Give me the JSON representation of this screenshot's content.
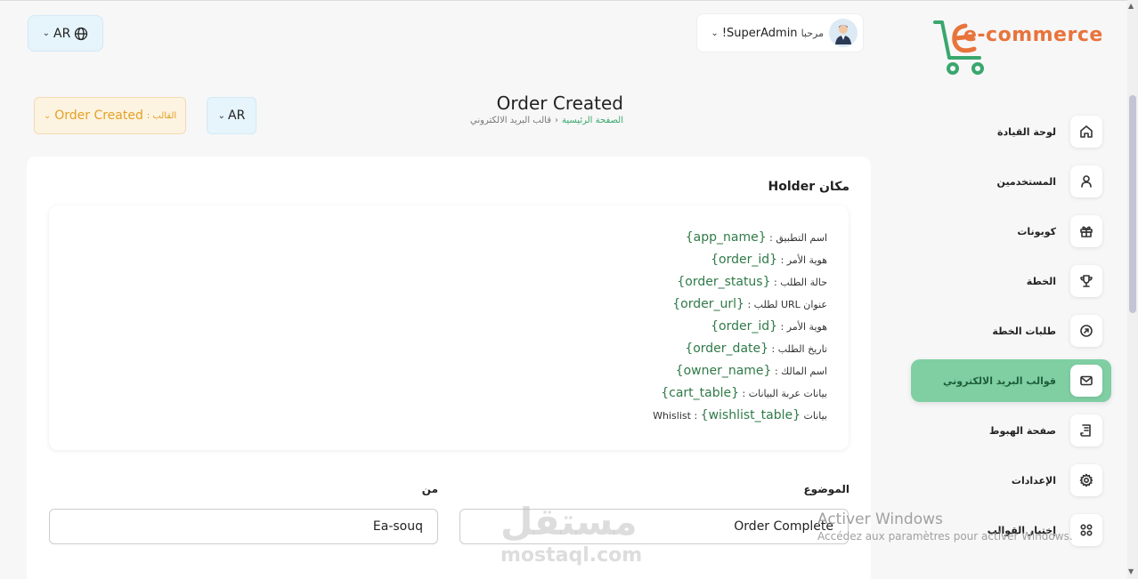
{
  "topbar": {
    "lang_label": "AR",
    "user_greeting": "مرحبا",
    "user_name": "SuperAdmin!",
    "logo_text": "e-commerce"
  },
  "header": {
    "template_label": "القالب :",
    "template_value": "Order Created",
    "lang_label": "AR",
    "page_title": "Order Created",
    "breadcrumb_home": "الصفحة الرئيسية",
    "breadcrumb_current": "قالب البريد الالكتروني"
  },
  "card": {
    "title": "مكان Holder",
    "placeholders": [
      {
        "key": "اسم التطبيق :",
        "value": "{app_name}"
      },
      {
        "key": "هوية الأمر :",
        "value": "{order_id}"
      },
      {
        "key": "حالة الطلب :",
        "value": "{order_status}"
      },
      {
        "key": "عنوان URL لطلب :",
        "value": "{order_url}"
      },
      {
        "key": "هوية الأمر :",
        "value": "{order_id}"
      },
      {
        "key": "تاريخ الطلب :",
        "value": "{order_date}"
      },
      {
        "key": "اسم المالك :",
        "value": "{owner_name}"
      },
      {
        "key": "بيانات عربة البيانات :",
        "value": "{cart_table}"
      },
      {
        "key": "بيانات Whislist :",
        "value": "{wishlist_table}"
      }
    ],
    "subject_label": "الموضوع",
    "subject_value": "Order Complete",
    "from_label": "من",
    "from_value": "Ea-souq"
  },
  "sidebar": {
    "items": [
      {
        "label": "لوحة القيادة",
        "icon": "home-icon"
      },
      {
        "label": "المستخدمين",
        "icon": "user-icon"
      },
      {
        "label": "كوبونات",
        "icon": "gift-icon"
      },
      {
        "label": "الخطة",
        "icon": "trophy-icon"
      },
      {
        "label": "طلبات الخطة",
        "icon": "arrow-circle-icon"
      },
      {
        "label": "قوالب البريد الالكتروني",
        "icon": "mail-icon",
        "active": true
      },
      {
        "label": "صفحة الهبوط",
        "icon": "document-icon"
      },
      {
        "label": "الإعدادات",
        "icon": "gear-icon"
      },
      {
        "label": "إختيار القوالب",
        "icon": "grid-icon"
      }
    ]
  },
  "watermark": {
    "line1": "Activer Windows",
    "line2": "Accédez aux paramètres pour activer Windows.",
    "site_logo": "مستقل",
    "site_url": "mostaql.com"
  },
  "colors": {
    "accent_green": "#7fcfa3",
    "placeholder_green": "#2f7a48",
    "template_orange": "#e3a125",
    "lang_blue_bg": "#e6f4fc"
  }
}
